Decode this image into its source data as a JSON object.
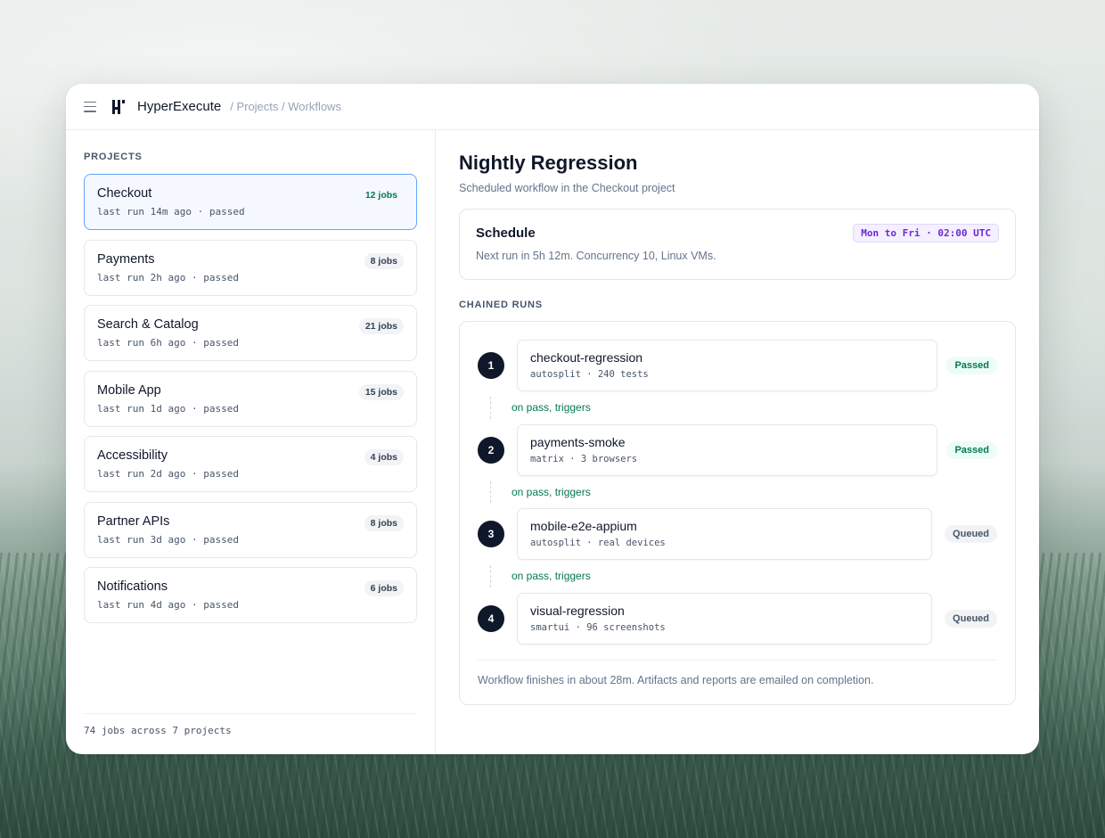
{
  "topbar": {
    "brand": "HyperExecute",
    "breadcrumb": "/ Projects / Workflows"
  },
  "sidebar": {
    "label": "PROJECTS",
    "projects": [
      {
        "name": "Checkout",
        "jobs": "12 jobs",
        "meta": "last run 14m ago · passed",
        "active": true
      },
      {
        "name": "Payments",
        "jobs": "8 jobs",
        "meta": "last run 2h ago · passed"
      },
      {
        "name": "Search & Catalog",
        "jobs": "21 jobs",
        "meta": "last run 6h ago · passed"
      },
      {
        "name": "Mobile App",
        "jobs": "15 jobs",
        "meta": "last run 1d ago · passed"
      },
      {
        "name": "Accessibility",
        "jobs": "4 jobs",
        "meta": "last run 2d ago · passed"
      },
      {
        "name": "Partner APIs",
        "jobs": "8 jobs",
        "meta": "last run 3d ago · passed"
      },
      {
        "name": "Notifications",
        "jobs": "6 jobs",
        "meta": "last run 4d ago · passed"
      }
    ],
    "footer": "74 jobs across 7 projects"
  },
  "workflow": {
    "title": "Nightly Regression",
    "subtitle": "Scheduled workflow in the Checkout project",
    "schedule": {
      "title": "Schedule",
      "cron": "Mon to Fri · 02:00 UTC",
      "note": "Next run in 5h 12m. Concurrency 10, Linux VMs."
    },
    "chained_label": "CHAINED RUNS",
    "runs": [
      {
        "num": "1",
        "name": "checkout-regression",
        "meta": "autosplit · 240 tests",
        "status": "Passed"
      },
      {
        "num": "2",
        "name": "payments-smoke",
        "meta": "matrix · 3 browsers",
        "status": "Passed"
      },
      {
        "num": "3",
        "name": "mobile-e2e-appium",
        "meta": "autosplit · real devices",
        "status": "Queued"
      },
      {
        "num": "4",
        "name": "visual-regression",
        "meta": "smartui · 96 screenshots",
        "status": "Queued"
      }
    ],
    "trigger_text": "on pass, triggers",
    "footer": "Workflow finishes in about 28m. Artifacts and reports are emailed on completion."
  },
  "colors": {
    "accent_blue": "#60a5fa",
    "passed_green": "#047857",
    "cron_purple": "#6d28d9",
    "dark": "#0f172a"
  }
}
